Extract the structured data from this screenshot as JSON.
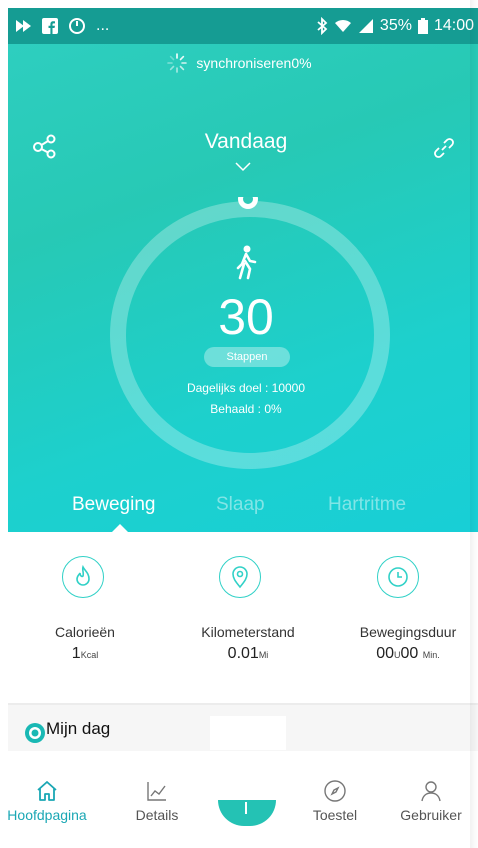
{
  "status_bar": {
    "left_icons": [
      "play-icon",
      "facebook-icon",
      "power-icon",
      "more-icon"
    ],
    "more_text": "...",
    "battery": "35%",
    "time": "14:00"
  },
  "sync": {
    "text": "synchroniseren0%"
  },
  "header": {
    "title": "Vandaag"
  },
  "summary": {
    "steps": "30",
    "steps_label": "Stappen",
    "goal_text": "Dagelijks doel : 10000",
    "achieved_text": "Behaald : 0%",
    "progress_percent": 0
  },
  "tabs": [
    {
      "label": "Beweging",
      "active": true
    },
    {
      "label": "Slaap",
      "active": false
    },
    {
      "label": "Hartritme",
      "active": false
    }
  ],
  "metrics": [
    {
      "label": "Calorieën",
      "value": "1",
      "unit": "Kcal",
      "icon": "flame-icon"
    },
    {
      "label": "Kilometerstand",
      "value": "0.01",
      "unit": "Mi",
      "icon": "location-pin-icon"
    },
    {
      "label": "Bewegingsduur",
      "value_h": "00",
      "h_unit": "U",
      "value_m": "00",
      "m_unit": "Min.",
      "icon": "clock-icon"
    }
  ],
  "my_day": {
    "label": "Mijn dag"
  },
  "bottom_nav": [
    {
      "label": "Hoofdpagina",
      "icon": "home-icon",
      "active": true
    },
    {
      "label": "Details",
      "icon": "chart-icon",
      "active": false
    },
    {
      "label": "Toestel",
      "icon": "compass-icon",
      "active": false
    },
    {
      "label": "Gebruiker",
      "icon": "user-icon",
      "active": false
    }
  ],
  "colors": {
    "accent": "#27c9b5",
    "nav_active": "#1aa7b4",
    "status_bar": "#159c93"
  }
}
